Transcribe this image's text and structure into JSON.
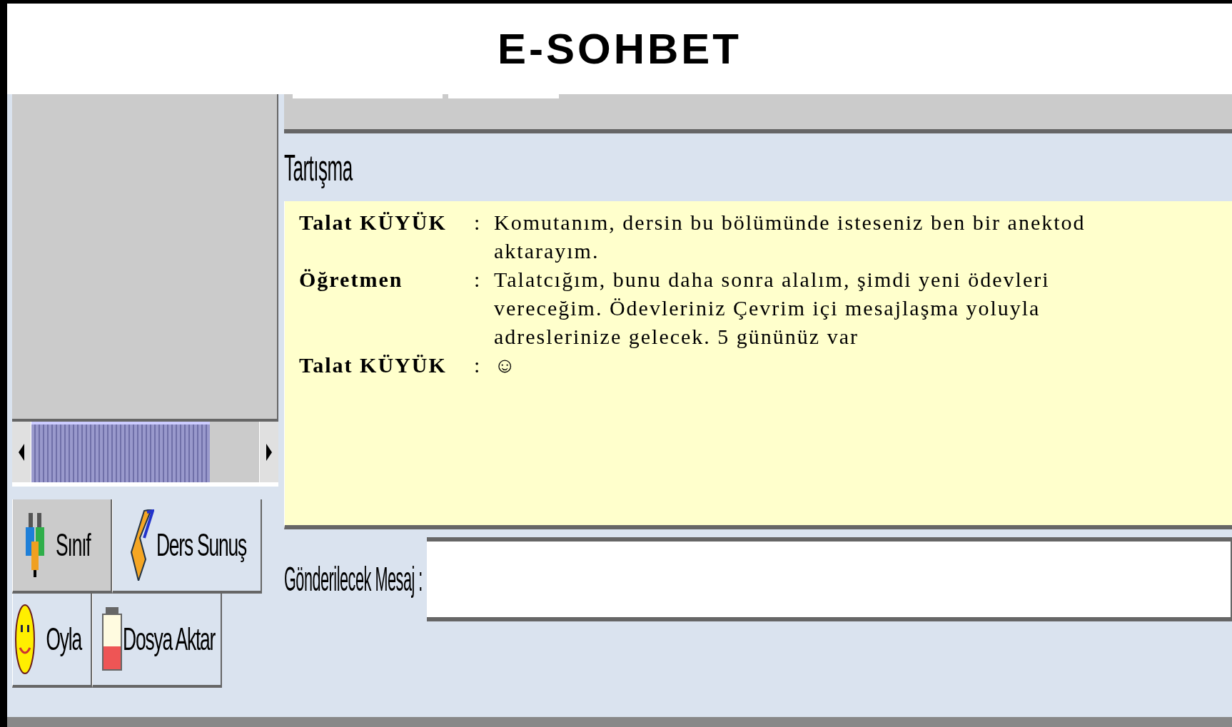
{
  "header": {
    "title": "E-SOHBET"
  },
  "discussion": {
    "title": "Tartışma",
    "messages": [
      {
        "sender": "Talat KÜYÜK",
        "separator": ":",
        "text": "Komutanım, dersin bu bölümünde isteseniz ben bir anektod aktarayım."
      },
      {
        "sender": "Öğretmen",
        "separator": ":",
        "text": " Talatcığım, bunu daha sonra alalım, şimdi yeni ödevleri vereceğim. Ödevleriniz Çevrim içi mesajlaşma yoluyla adreslerinize gelecek. 5 gününüz var"
      },
      {
        "sender": "Talat KÜYÜK",
        "separator": ":",
        "text": "☺"
      }
    ]
  },
  "compose": {
    "label": "Gönderilecek Mesaj :"
  },
  "tabs": [
    {
      "label": "Sınıf",
      "kind": "people",
      "selected": true
    },
    {
      "label": "Ders Sunuş",
      "kind": "presentation",
      "selected": false
    },
    {
      "label": "Oyla",
      "kind": "vote",
      "selected": false
    },
    {
      "label": "Dosya Aktar",
      "kind": "file",
      "selected": false
    }
  ]
}
